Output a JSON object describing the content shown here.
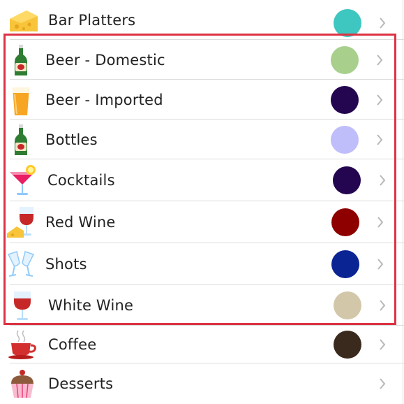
{
  "rows": [
    {
      "label": "Bar Platters",
      "color": "#3ec6c0",
      "icon": "cheese-icon"
    },
    {
      "label": "Beer - Domestic",
      "color": "#a8d08c",
      "icon": "beer-bottle-icon"
    },
    {
      "label": "Beer - Imported",
      "color": "#23064f",
      "icon": "beer-glass-icon"
    },
    {
      "label": "Bottles",
      "color": "#c0bdfb",
      "icon": "beer-bottle-icon"
    },
    {
      "label": "Cocktails",
      "color": "#23064f",
      "icon": "cocktail-glass-icon"
    },
    {
      "label": "Red Wine",
      "color": "#8e0000",
      "icon": "red-wine-cheese-icon"
    },
    {
      "label": "Shots",
      "color": "#0a2494",
      "icon": "champagne-glasses-icon"
    },
    {
      "label": "White Wine",
      "color": "#d2c8a9",
      "icon": "wine-glass-icon"
    },
    {
      "label": "Coffee",
      "color": "#3a2a1d",
      "icon": "coffee-cup-icon"
    },
    {
      "label": "Desserts",
      "color": "",
      "icon": "cupcake-icon"
    }
  ],
  "selection": {
    "color": "#dd3344"
  },
  "chevron": {
    "icon": "chevron-right-icon",
    "color": "#b8b8b8"
  }
}
